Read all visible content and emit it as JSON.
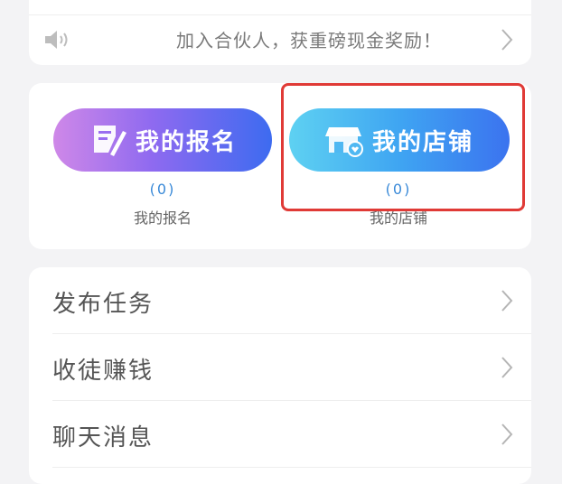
{
  "notice": {
    "text": "加入合伙人，获重磅现金奖励！"
  },
  "shortcuts": [
    {
      "button_label": "我的报名",
      "count": "(0)",
      "label": "我的报名"
    },
    {
      "button_label": "我的店铺",
      "count": "(0)",
      "label": "我的店铺"
    }
  ],
  "menu": [
    {
      "label": "发布任务"
    },
    {
      "label": "收徒赚钱"
    },
    {
      "label": "聊天消息"
    }
  ],
  "colors": {
    "highlight": "#e03a36",
    "count_text": "#3a8ad8"
  },
  "icons": [
    "speaker-icon",
    "chevron-right-icon",
    "edit-form-icon",
    "store-icon"
  ]
}
